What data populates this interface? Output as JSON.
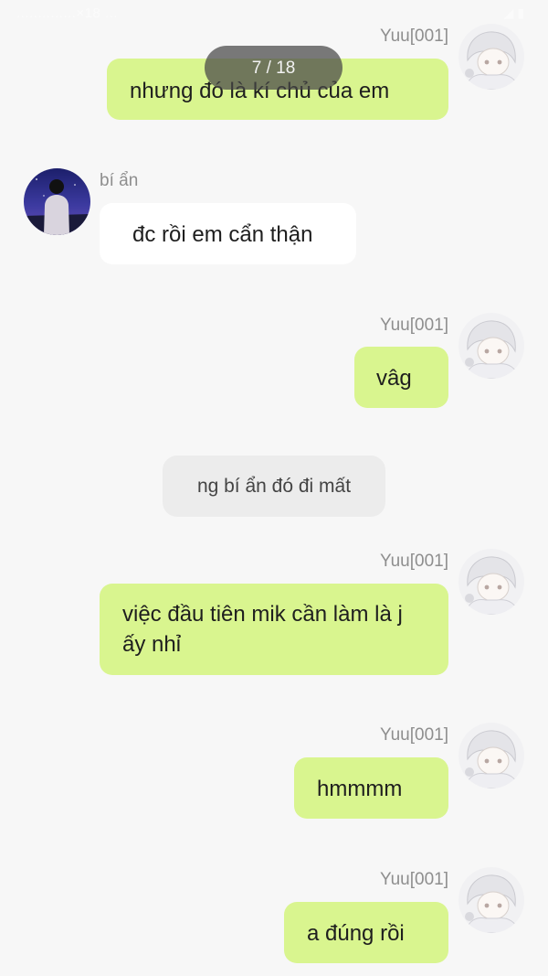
{
  "status_bar": {
    "left_text": "..............×18 ...",
    "right_text": "◢ ▮"
  },
  "viewer": {
    "page_indicator": "7 / 18"
  },
  "system_note": "ng bí ẩn đó đi mất",
  "messages": [
    {
      "sender": "Yuu[001]",
      "side": "right",
      "text": "nhưng đó là kí chủ của em"
    },
    {
      "sender": "bí ẩn",
      "side": "left",
      "text": "đc rồi em cẩn thận"
    },
    {
      "sender": "Yuu[001]",
      "side": "right",
      "text": "vâg"
    },
    {
      "sender": "Yuu[001]",
      "side": "right",
      "text": "việc đầu tiên mik cần làm là j ấy nhỉ"
    },
    {
      "sender": "Yuu[001]",
      "side": "right",
      "text": "hmmmm"
    },
    {
      "sender": "Yuu[001]",
      "side": "right",
      "text": "a đúng rồi"
    }
  ],
  "colors": {
    "background": "#f7f7f7",
    "own_bubble": "#d9f58f",
    "other_bubble": "#ffffff",
    "name_text": "#8e8e8e",
    "system_bubble": "#ececec"
  },
  "icons": {
    "own_avatar": "anime-white-hair-avatar-icon",
    "other_avatar": "silhouette-night-sky-avatar-icon"
  }
}
